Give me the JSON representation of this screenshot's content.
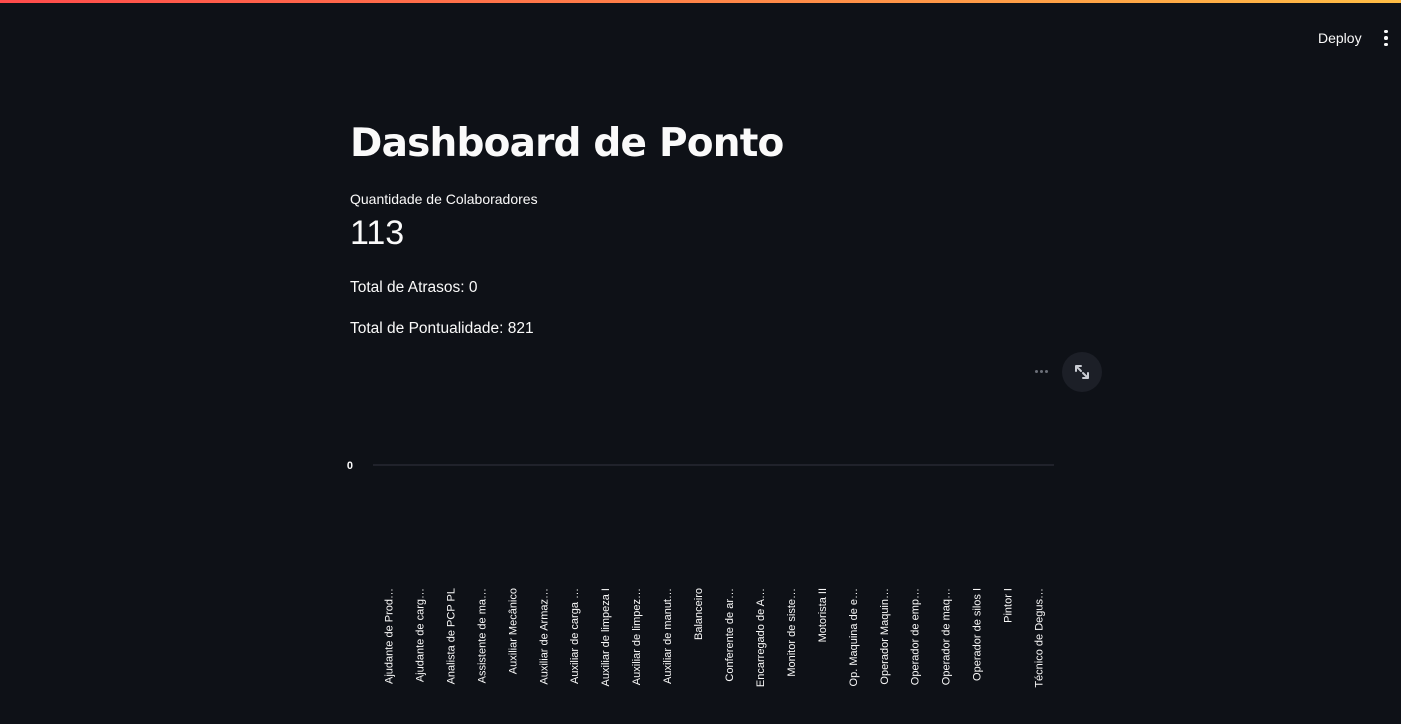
{
  "header": {
    "deploy_label": "Deploy",
    "menu_icon": "vertical-ellipsis-icon"
  },
  "main": {
    "title": "Dashboard de Ponto",
    "metric": {
      "label": "Quantidade de Colaboradores",
      "value": "113"
    },
    "total_atrasos": "Total de Atrasos: 0",
    "total_pontualidade": "Total de Pontualidade: 821"
  },
  "chart_toolbar": {
    "more_icon": "horizontal-ellipsis-icon",
    "fullscreen_icon": "expand-icon"
  },
  "chart_data": {
    "type": "bar",
    "categories": [
      "Ajudante de Prod…",
      "Ajudante de carg…",
      "Analista de PCP PL",
      "Assistente de ma…",
      "Auxiliar Mecânico",
      "Auxiliar de Armaz…",
      "Auxiliar de carga …",
      "Auxiliar de limpeza I",
      "Auxiliar de limpez…",
      "Auxiliar de manut…",
      "Balanceiro",
      "Conferente de ar…",
      "Encarregado de A…",
      "Monitor de siste…",
      "Motorista II",
      "Op. Maquina de e…",
      "Operador Maquin…",
      "Operador de emp…",
      "Operador de maq…",
      "Operador de silos I",
      "Pintor I",
      "Técnico de Degus…"
    ],
    "values": [
      0,
      0,
      0,
      0,
      0,
      0,
      0,
      0,
      0,
      0,
      0,
      0,
      0,
      0,
      0,
      0,
      0,
      0,
      0,
      0,
      0,
      0
    ],
    "y_ticks": [
      "0"
    ],
    "colors": {
      "grid": "#31333f",
      "tick_text": "#fafafa",
      "bar": "#83c9ff"
    }
  }
}
